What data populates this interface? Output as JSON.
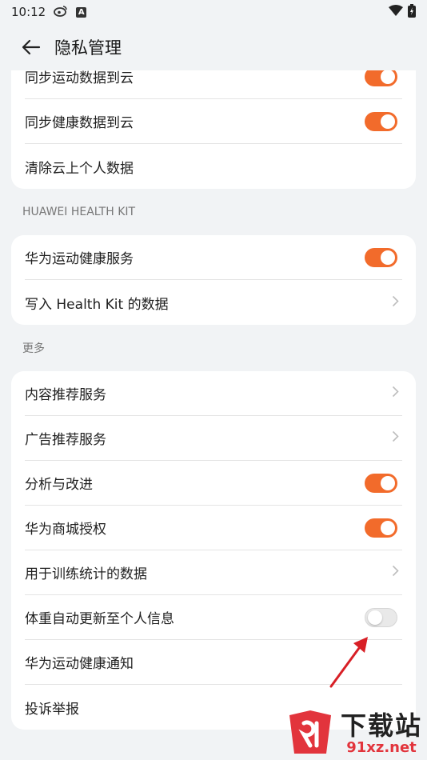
{
  "status_bar": {
    "time": "10:12",
    "badge": "A"
  },
  "header": {
    "title": "隐私管理"
  },
  "cards": {
    "cloud": {
      "items": [
        {
          "label": "同步运动数据到云",
          "control": "toggle",
          "on": true
        },
        {
          "label": "同步健康数据到云",
          "control": "toggle",
          "on": true
        },
        {
          "label": "清除云上个人数据",
          "control": "none"
        }
      ]
    },
    "healthkit": {
      "header": "HUAWEI HEALTH KIT",
      "items": [
        {
          "label": "华为运动健康服务",
          "control": "toggle",
          "on": true
        },
        {
          "label": "写入 Health Kit 的数据",
          "control": "chevron"
        }
      ]
    },
    "more": {
      "header": "更多",
      "items": [
        {
          "label": "内容推荐服务",
          "control": "chevron"
        },
        {
          "label": "广告推荐服务",
          "control": "chevron"
        },
        {
          "label": "分析与改进",
          "control": "toggle",
          "on": true
        },
        {
          "label": "华为商城授权",
          "control": "toggle",
          "on": true
        },
        {
          "label": "用于训练统计的数据",
          "control": "chevron"
        },
        {
          "label": "体重自动更新至个人信息",
          "control": "toggle",
          "on": false
        },
        {
          "label": "华为运动健康通知",
          "control": "none"
        },
        {
          "label": "投诉举报",
          "control": "none"
        }
      ]
    }
  },
  "watermark": {
    "main": "下载站",
    "sub": "91xz.net"
  },
  "icons": {
    "back": "arrow-left-icon",
    "wifi": "wifi-icon",
    "battery": "battery-charging-icon",
    "weibo": "weibo-icon",
    "chevron": "chevron-right-icon"
  },
  "colors": {
    "accent": "#f26b2b",
    "background": "#f1f3f5",
    "card": "#ffffff",
    "annotation": "#d81f26"
  }
}
